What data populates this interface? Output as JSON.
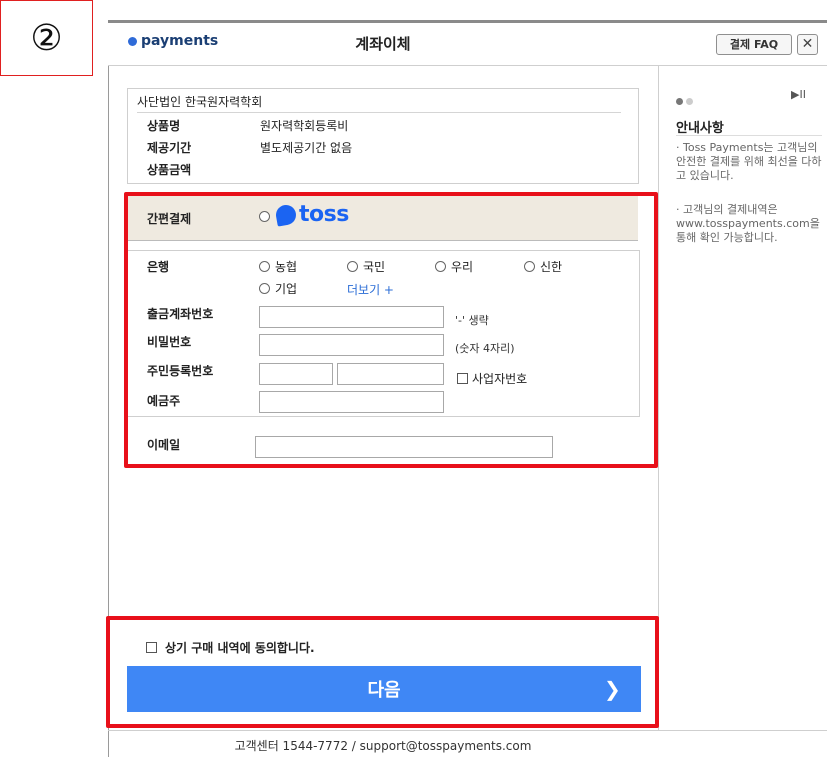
{
  "step": {
    "marker": "②"
  },
  "header": {
    "logo_text": "payments",
    "title": "계좌이체",
    "faq_label": "결제 FAQ",
    "close_label": "✕"
  },
  "product": {
    "org": "사단법인 한국원자력학회",
    "name_label": "상품명",
    "name_value": "원자력학회등록비",
    "period_label": "제공기간",
    "period_value": "별도제공기간 없음",
    "amount_label": "상품금액"
  },
  "easy_pay": {
    "label": "간편결제",
    "toss_text": "toss"
  },
  "bank": {
    "label": "은행",
    "options": [
      "농협",
      "국민",
      "우리",
      "신한",
      "기업"
    ],
    "more_label": "더보기 +"
  },
  "form": {
    "account_label": "출금계좌번호",
    "account_hint": "'-' 생략",
    "password_label": "비밀번호",
    "password_hint": "(숫자 4자리)",
    "rrn_label": "주민등록번호",
    "business_label": "사업자번호",
    "owner_label": "예금주",
    "email_label": "이메일"
  },
  "agree": {
    "label": "상기 구매 내역에 동의합니다."
  },
  "next": {
    "label": "다음",
    "arrow": "❯"
  },
  "side": {
    "play_label": "▶II",
    "title": "안내사항",
    "note1": "· Toss Payments는 고객님의 안전한 결제를 위해 최선을 다하고 있습니다.",
    "note2": "· 고객님의 결제내역은 www.tosspayments.com을 통해 확인 가능합니다."
  },
  "footer": {
    "text": "고객센터 1544-7772 / support@tosspayments.com"
  },
  "colors": {
    "accent": "#3f87f5",
    "highlight": "#e8101a",
    "toss": "#1b64f2"
  }
}
